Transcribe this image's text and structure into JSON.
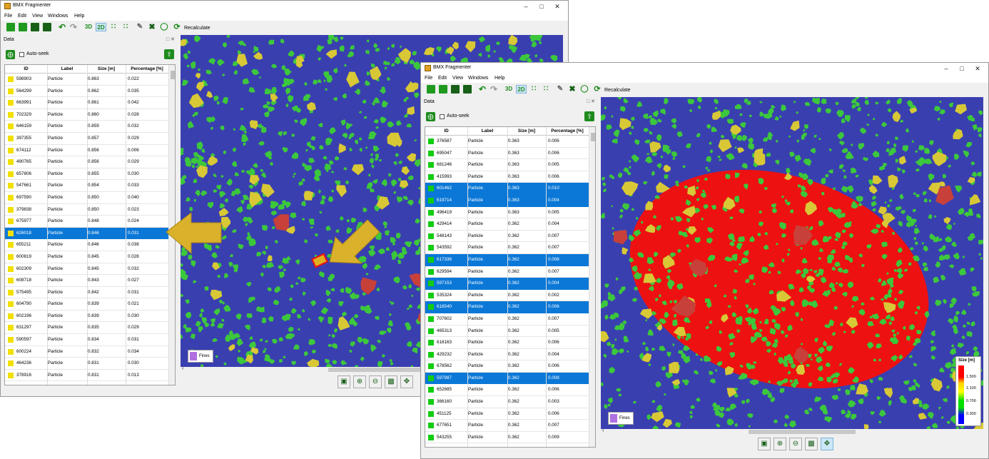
{
  "app": {
    "title": "BMX Fragmenter",
    "menu": [
      "File",
      "Edit",
      "View",
      "Windows",
      "Help"
    ],
    "toolbar": {
      "btn_3d": "3D",
      "btn_2d": "2D",
      "recalculate": "Recalculate"
    }
  },
  "panel": {
    "title": "Data",
    "autoseek": "Auto-seek",
    "columns": [
      "ID",
      "Label",
      "Size [m]",
      "Percentage [%]"
    ]
  },
  "colors": {
    "yellow": "#f2e000",
    "green": "#12cc12",
    "selected": "#0b78d7",
    "fines": "#b070e0"
  },
  "left": {
    "fines_label": "Fines",
    "rows": [
      {
        "id": "598903",
        "label": "Particle",
        "size": "0.863",
        "pct": "0.022",
        "sel": false
      },
      {
        "id": "564299",
        "label": "Particle",
        "size": "0.862",
        "pct": "0.035",
        "sel": false
      },
      {
        "id": "663991",
        "label": "Particle",
        "size": "0.861",
        "pct": "0.042",
        "sel": false
      },
      {
        "id": "702329",
        "label": "Particle",
        "size": "0.860",
        "pct": "0.028",
        "sel": false
      },
      {
        "id": "646159",
        "label": "Particle",
        "size": "0.859",
        "pct": "0.032",
        "sel": false
      },
      {
        "id": "397355",
        "label": "Particle",
        "size": "0.857",
        "pct": "0.029",
        "sel": false
      },
      {
        "id": "674112",
        "label": "Particle",
        "size": "0.856",
        "pct": "0.006",
        "sel": false
      },
      {
        "id": "490765",
        "label": "Particle",
        "size": "0.856",
        "pct": "0.029",
        "sel": false
      },
      {
        "id": "657806",
        "label": "Particle",
        "size": "0.855",
        "pct": "0.030",
        "sel": false
      },
      {
        "id": "547661",
        "label": "Particle",
        "size": "0.854",
        "pct": "0.033",
        "sel": false
      },
      {
        "id": "697590",
        "label": "Particle",
        "size": "0.850",
        "pct": "0.040",
        "sel": false
      },
      {
        "id": "379838",
        "label": "Particle",
        "size": "0.850",
        "pct": "0.023",
        "sel": false
      },
      {
        "id": "675977",
        "label": "Particle",
        "size": "0.848",
        "pct": "0.024",
        "sel": false
      },
      {
        "id": "626018",
        "label": "Particle",
        "size": "0.846",
        "pct": "0.031",
        "sel": true
      },
      {
        "id": "655211",
        "label": "Particle",
        "size": "0.846",
        "pct": "0.038",
        "sel": false
      },
      {
        "id": "600819",
        "label": "Particle",
        "size": "0.845",
        "pct": "0.028",
        "sel": false
      },
      {
        "id": "602309",
        "label": "Particle",
        "size": "0.845",
        "pct": "0.032",
        "sel": false
      },
      {
        "id": "608718",
        "label": "Particle",
        "size": "0.843",
        "pct": "0.027",
        "sel": false
      },
      {
        "id": "575495",
        "label": "Particle",
        "size": "0.842",
        "pct": "0.031",
        "sel": false
      },
      {
        "id": "604790",
        "label": "Particle",
        "size": "0.839",
        "pct": "0.021",
        "sel": false
      },
      {
        "id": "602196",
        "label": "Particle",
        "size": "0.839",
        "pct": "0.030",
        "sel": false
      },
      {
        "id": "631297",
        "label": "Particle",
        "size": "0.835",
        "pct": "0.029",
        "sel": false
      },
      {
        "id": "590597",
        "label": "Particle",
        "size": "0.834",
        "pct": "0.031",
        "sel": false
      },
      {
        "id": "600224",
        "label": "Particle",
        "size": "0.832",
        "pct": "0.034",
        "sel": false
      },
      {
        "id": "464236",
        "label": "Particle",
        "size": "0.831",
        "pct": "0.030",
        "sel": false
      },
      {
        "id": "378916",
        "label": "Particle",
        "size": "0.831",
        "pct": "0.013",
        "sel": false
      }
    ]
  },
  "right": {
    "fines_label": "Fines",
    "legend": {
      "title": "Size [m]",
      "values": [
        "1.500",
        "1.100",
        "0.700",
        "0.300"
      ]
    },
    "rows": [
      {
        "id": "376587",
        "label": "Particle",
        "size": "0.363",
        "pct": "0.006",
        "sel": false
      },
      {
        "id": "695047",
        "label": "Particle",
        "size": "0.363",
        "pct": "0.006",
        "sel": false
      },
      {
        "id": "681246",
        "label": "Particle",
        "size": "0.363",
        "pct": "0.005",
        "sel": false
      },
      {
        "id": "415993",
        "label": "Particle",
        "size": "0.363",
        "pct": "0.006",
        "sel": false
      },
      {
        "id": "601462",
        "label": "Particle",
        "size": "0.363",
        "pct": "0.010",
        "sel": true
      },
      {
        "id": "619714",
        "label": "Particle",
        "size": "0.363",
        "pct": "0.004",
        "sel": true
      },
      {
        "id": "496419",
        "label": "Particle",
        "size": "0.363",
        "pct": "0.005",
        "sel": false
      },
      {
        "id": "429414",
        "label": "Particle",
        "size": "0.362",
        "pct": "0.004",
        "sel": false
      },
      {
        "id": "548143",
        "label": "Particle",
        "size": "0.362",
        "pct": "0.007",
        "sel": false
      },
      {
        "id": "543592",
        "label": "Particle",
        "size": "0.362",
        "pct": "0.007",
        "sel": false
      },
      {
        "id": "617336",
        "label": "Particle",
        "size": "0.362",
        "pct": "0.008",
        "sel": true
      },
      {
        "id": "629594",
        "label": "Particle",
        "size": "0.362",
        "pct": "0.007",
        "sel": false
      },
      {
        "id": "597153",
        "label": "Particle",
        "size": "0.362",
        "pct": "0.004",
        "sel": true
      },
      {
        "id": "535324",
        "label": "Particle",
        "size": "0.362",
        "pct": "0.002",
        "sel": false
      },
      {
        "id": "618540",
        "label": "Particle",
        "size": "0.362",
        "pct": "0.006",
        "sel": true
      },
      {
        "id": "707602",
        "label": "Particle",
        "size": "0.362",
        "pct": "0.007",
        "sel": false
      },
      {
        "id": "465313",
        "label": "Particle",
        "size": "0.362",
        "pct": "0.005",
        "sel": false
      },
      {
        "id": "618163",
        "label": "Particle",
        "size": "0.362",
        "pct": "0.006",
        "sel": false
      },
      {
        "id": "429232",
        "label": "Particle",
        "size": "0.362",
        "pct": "0.004",
        "sel": false
      },
      {
        "id": "678562",
        "label": "Particle",
        "size": "0.362",
        "pct": "0.006",
        "sel": false
      },
      {
        "id": "597987",
        "label": "Particle",
        "size": "0.362",
        "pct": "0.008",
        "sel": true
      },
      {
        "id": "652685",
        "label": "Particle",
        "size": "0.362",
        "pct": "0.006",
        "sel": false
      },
      {
        "id": "366160",
        "label": "Particle",
        "size": "0.362",
        "pct": "0.003",
        "sel": false
      },
      {
        "id": "451125",
        "label": "Particle",
        "size": "0.362",
        "pct": "0.006",
        "sel": false
      },
      {
        "id": "677651",
        "label": "Particle",
        "size": "0.362",
        "pct": "0.007",
        "sel": false
      },
      {
        "id": "543255",
        "label": "Particle",
        "size": "0.362",
        "pct": "0.009",
        "sel": false
      }
    ]
  }
}
